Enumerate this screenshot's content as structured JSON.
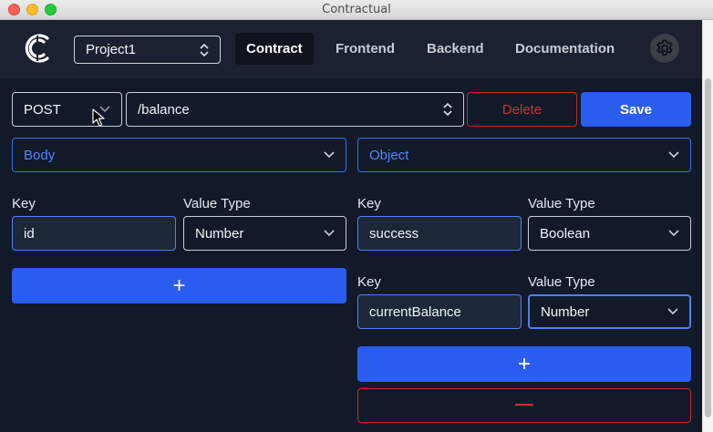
{
  "window": {
    "title": "Contractual"
  },
  "nav": {
    "project": "Project1",
    "tabs": [
      {
        "label": "Contract",
        "active": true
      },
      {
        "label": "Frontend",
        "active": false
      },
      {
        "label": "Backend",
        "active": false
      },
      {
        "label": "Documentation",
        "active": false
      }
    ]
  },
  "request": {
    "method": "POST",
    "path": "/balance",
    "delete_label": "Delete",
    "save_label": "Save"
  },
  "left_panel": {
    "section": "Body",
    "key_label": "Key",
    "value_type_label": "Value Type",
    "fields": [
      {
        "key": "id",
        "type": "Number"
      }
    ],
    "add_label": "+"
  },
  "right_panel": {
    "section": "Object",
    "fields": [
      {
        "key_label": "Key",
        "value_type_label": "Value Type",
        "key": "success",
        "type": "Boolean"
      },
      {
        "key_label": "Key",
        "value_type_label": "Value Type",
        "key": "currentBalance",
        "type": "Number"
      }
    ],
    "add_label": "+",
    "remove_label": "—"
  },
  "colors": {
    "accent": "#2a5df0",
    "danger": "#c02a2a",
    "background": "#121a29",
    "navbar": "#1b2130"
  }
}
